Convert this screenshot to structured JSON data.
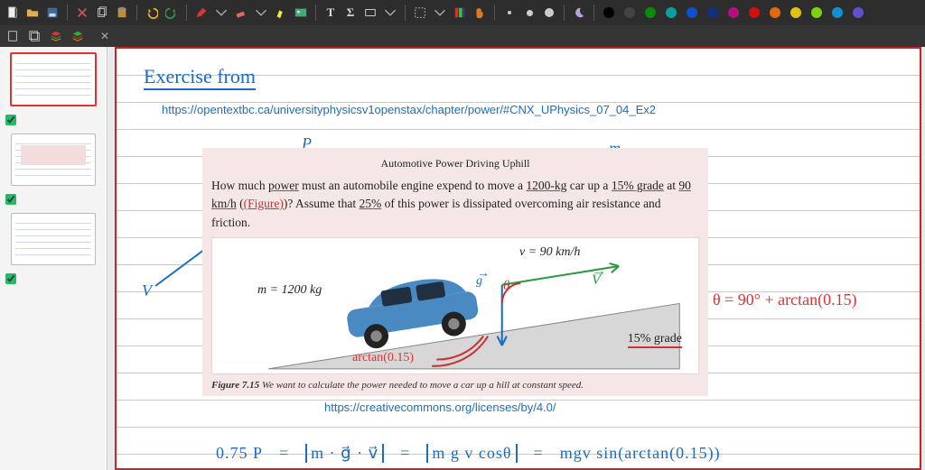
{
  "toolbar": {
    "colors": [
      "#000000",
      "#444444",
      "#0a8a0a",
      "#0aa0a0",
      "#1050d0",
      "#103080",
      "#b01080",
      "#d01010",
      "#e06a10",
      "#e0c010",
      "#80d010",
      "#1090d0",
      "#6050d0"
    ]
  },
  "page": {
    "title_hand": "Exercise from",
    "source_url": "https://opentextbc.ca/universityphysicsv1openstax/chapter/power/#CNX_UPhysics_07_04_Ex2",
    "license_url": "https://creativecommons.org/licenses/by/4.0/",
    "annot_P": "P",
    "annot_m": "m",
    "annot_V": "V",
    "annot_arctan": "arctan(0.15)",
    "annot_theta_expr": "θ = 90° + arctan(0.15)"
  },
  "problem": {
    "title": "Automotive Power Driving Uphill",
    "text_pre": "How much ",
    "text_power": "power",
    "text_mid1": " must an automobile engine expend to move a ",
    "text_mass": "1200-kg",
    "text_mid2": " car up a ",
    "text_grade": "15% grade",
    "text_mid3": " at ",
    "text_speed": "90 km/h",
    "text_mid4": " (",
    "text_figlabel": "(Figure)",
    "text_mid5": ")? Assume that ",
    "text_pct": "25%",
    "text_tail": " of this power is dissipated overcoming air resistance and friction.",
    "diag_v": "v = 90 km/h",
    "diag_m": "m = 1200 kg",
    "diag_g": "g",
    "diag_theta": "θ",
    "diag_Vvec": "V",
    "diag_grade": "15% grade",
    "caption_b": "Figure 7.15",
    "caption_t": " We want to calculate the power needed to move a car up a hill at constant speed."
  },
  "equation": {
    "lhs": "0.75 P",
    "eq1": "=",
    "t1": "m · g⃗ · v⃗",
    "eq2": "=",
    "t2": "m g v cosθ",
    "eq3": "=",
    "t3": "mgv sin(arctan(0.15))"
  }
}
